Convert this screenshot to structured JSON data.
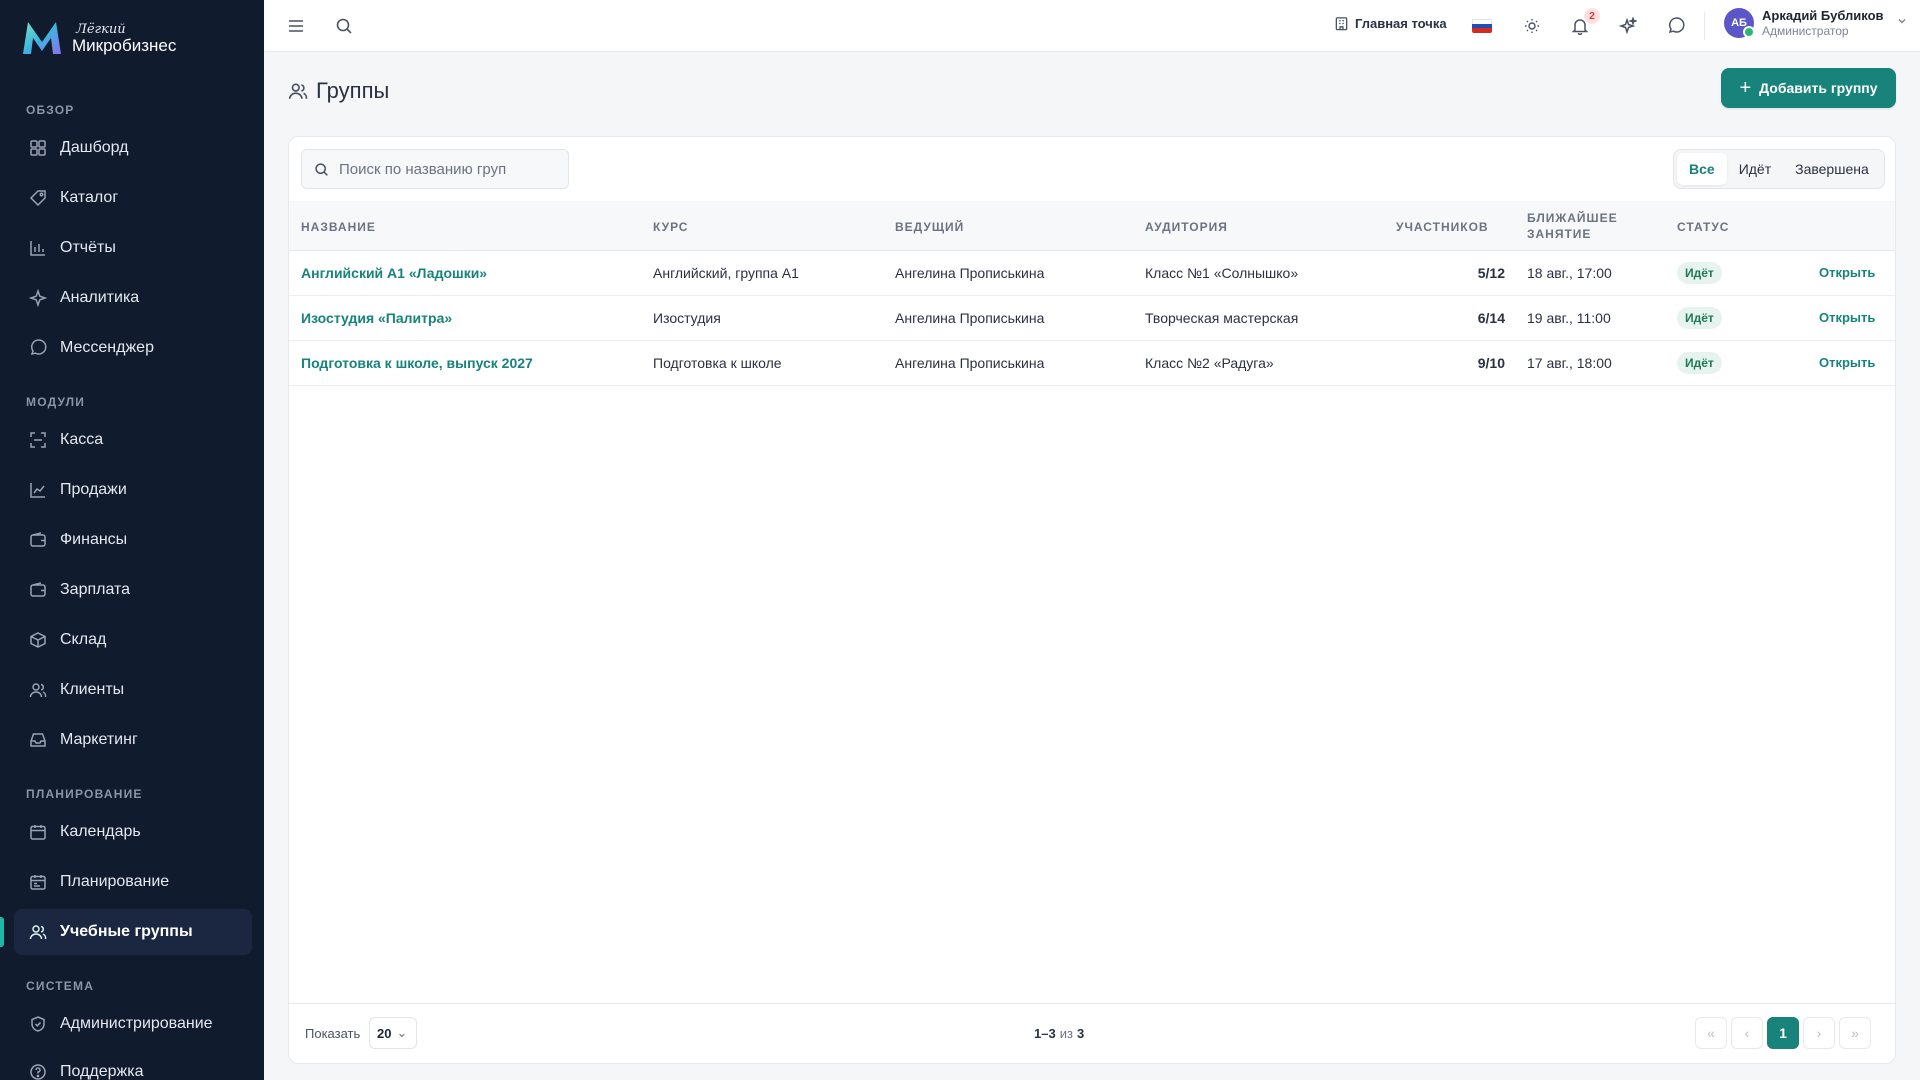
{
  "brand": {
    "line1": "Лёгкий",
    "line2": "Микробизнес"
  },
  "sidebar": {
    "sections": [
      {
        "title": "ОБЗОР"
      },
      {
        "title": "МОДУЛИ"
      },
      {
        "title": "ПЛАНИРОВАНИЕ"
      },
      {
        "title": "СИСТЕМА"
      }
    ],
    "items": [
      {
        "label": "Дашборд",
        "icon": "dashboard-icon"
      },
      {
        "label": "Каталог",
        "icon": "tag-icon"
      },
      {
        "label": "Отчёты",
        "icon": "bar-chart-icon"
      },
      {
        "label": "Аналитика",
        "icon": "sparkle-icon"
      },
      {
        "label": "Мессенджер",
        "icon": "chat-icon"
      },
      {
        "label": "Касса",
        "icon": "scan-icon"
      },
      {
        "label": "Продажи",
        "icon": "line-chart-icon"
      },
      {
        "label": "Финансы",
        "icon": "wallet-icon"
      },
      {
        "label": "Зарплата",
        "icon": "wallet-icon"
      },
      {
        "label": "Склад",
        "icon": "box-icon"
      },
      {
        "label": "Клиенты",
        "icon": "users-icon"
      },
      {
        "label": "Маркетинг",
        "icon": "inbox-icon"
      },
      {
        "label": "Календарь",
        "icon": "calendar-icon"
      },
      {
        "label": "Планирование",
        "icon": "calendar-icon"
      },
      {
        "label": "Учебные группы",
        "icon": "users-icon",
        "active": true
      },
      {
        "label": "Администрирование",
        "icon": "shield-icon"
      },
      {
        "label": "Поддержка",
        "icon": "help-icon"
      }
    ]
  },
  "topbar": {
    "branch": "Главная точка",
    "notifications_count": "2",
    "user": {
      "initials": "АБ",
      "name": "Аркадий Бубликов",
      "role": "Администратор"
    }
  },
  "page": {
    "title": "Группы",
    "add_button": "Добавить группу",
    "search_placeholder": "Поиск по названию груп",
    "filters": [
      {
        "label": "Все",
        "active": true
      },
      {
        "label": "Идёт",
        "active": false
      },
      {
        "label": "Завершена",
        "active": false
      }
    ]
  },
  "table": {
    "columns": {
      "name": "НАЗВАНИЕ",
      "course": "КУРС",
      "host": "ВЕДУЩИЙ",
      "room": "АУДИТОРИЯ",
      "members": "УЧАСТНИКОВ",
      "next_line1": "БЛИЖАЙШЕЕ",
      "next_line2": "ЗАНЯТИЕ",
      "status": "СТАТУС"
    },
    "rows": [
      {
        "name": "Английский А1 «Ладошки»",
        "course": "Английский, группа А1",
        "host": "Ангелина Прописькина",
        "room": "Класс №1 «Солнышко»",
        "members": "5/12",
        "next": "18 авг., 17:00",
        "status": "Идёт",
        "action": "Открыть"
      },
      {
        "name": "Изостудия «Палитра»",
        "course": "Изостудия",
        "host": "Ангелина Прописькина",
        "room": "Творческая мастерская",
        "members": "6/14",
        "next": "19 авг., 11:00",
        "status": "Идёт",
        "action": "Открыть"
      },
      {
        "name": "Подготовка к школе, выпуск 2027",
        "course": "Подготовка к школе",
        "host": "Ангелина Прописькина",
        "room": "Класс №2 «Радуга»",
        "members": "9/10",
        "next": "17 авг., 18:00",
        "status": "Идёт",
        "action": "Открыть"
      }
    ]
  },
  "pagination": {
    "show_label": "Показать",
    "page_size": "20",
    "range": "1–3",
    "of": "из",
    "total": "3",
    "current_page": "1",
    "first": "«",
    "prev": "‹",
    "next": "›",
    "last": "»"
  },
  "colors": {
    "sidebar_bg": "#111b2e",
    "accent": "#17837a",
    "status_bg": "#e6f3ee"
  }
}
